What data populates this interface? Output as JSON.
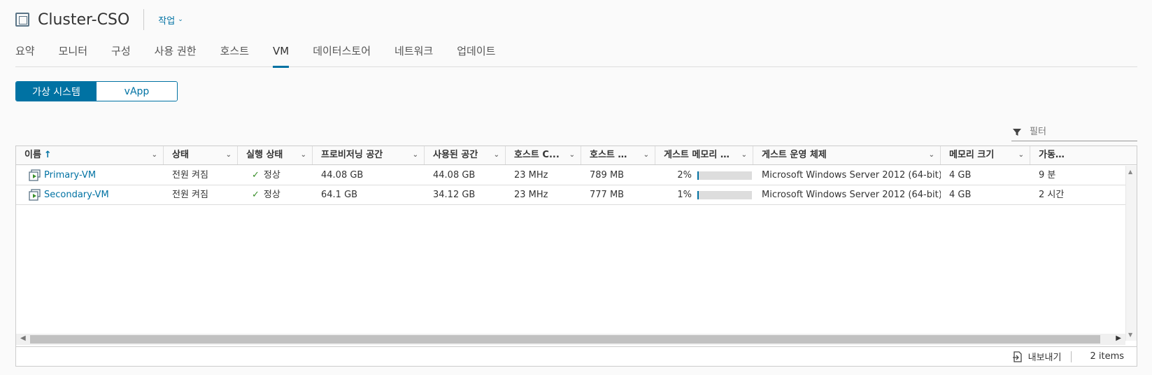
{
  "header": {
    "title": "Cluster-CSO",
    "actions_label": "작업"
  },
  "tabs": [
    {
      "label": "요약"
    },
    {
      "label": "모니터"
    },
    {
      "label": "구성"
    },
    {
      "label": "사용 권한"
    },
    {
      "label": "호스트"
    },
    {
      "label": "VM"
    },
    {
      "label": "데이터스토어"
    },
    {
      "label": "네트워크"
    },
    {
      "label": "업데이트"
    }
  ],
  "active_tab": "VM",
  "segment": {
    "vms_label": "가상 시스템",
    "vapp_label": "vApp",
    "active": "가상 시스템"
  },
  "filter": {
    "placeholder": "필터"
  },
  "grid": {
    "columns": [
      {
        "label": "이름"
      },
      {
        "label": "상태"
      },
      {
        "label": "실행 상태"
      },
      {
        "label": "프로비저닝 공간"
      },
      {
        "label": "사용된 공간"
      },
      {
        "label": "호스트 C..."
      },
      {
        "label": "호스트 메..."
      },
      {
        "label": "게스트 메모리 -..."
      },
      {
        "label": "게스트 운영 체제"
      },
      {
        "label": "메모리 크기"
      },
      {
        "label": "가동 ..."
      }
    ],
    "sort_column": "이름",
    "sort_direction": "ascending",
    "rows": [
      {
        "name": "Primary-VM",
        "state": "전원 켜짐",
        "run_state": "정상",
        "provisioned": "44.08 GB",
        "used": "44.08 GB",
        "host_cpu": "23 MHz",
        "host_mem": "789 MB",
        "guest_mem_pct": "2%",
        "guest_mem_fraction": 0.02,
        "guest_os": "Microsoft Windows Server 2012 (64-bit)",
        "mem_size": "4 GB",
        "uptime": "9 분"
      },
      {
        "name": "Secondary-VM",
        "state": "전원 켜짐",
        "run_state": "정상",
        "provisioned": "64.1 GB",
        "used": "34.12 GB",
        "host_cpu": "23 MHz",
        "host_mem": "777 MB",
        "guest_mem_pct": "1%",
        "guest_mem_fraction": 0.01,
        "guest_os": "Microsoft Windows Server 2012 (64-bit)",
        "mem_size": "4 GB",
        "uptime": "2 시간"
      }
    ]
  },
  "footer": {
    "export_label": "내보내기",
    "item_count": "2 items"
  },
  "colors": {
    "accent": "#0072a3",
    "ok": "#3a8f2a"
  },
  "icons": {
    "cluster": "cluster-icon",
    "actions": "chevron-down-icon",
    "filter": "filter-icon",
    "vm": "vm-icon",
    "ok": "check-icon",
    "export": "export-icon"
  }
}
